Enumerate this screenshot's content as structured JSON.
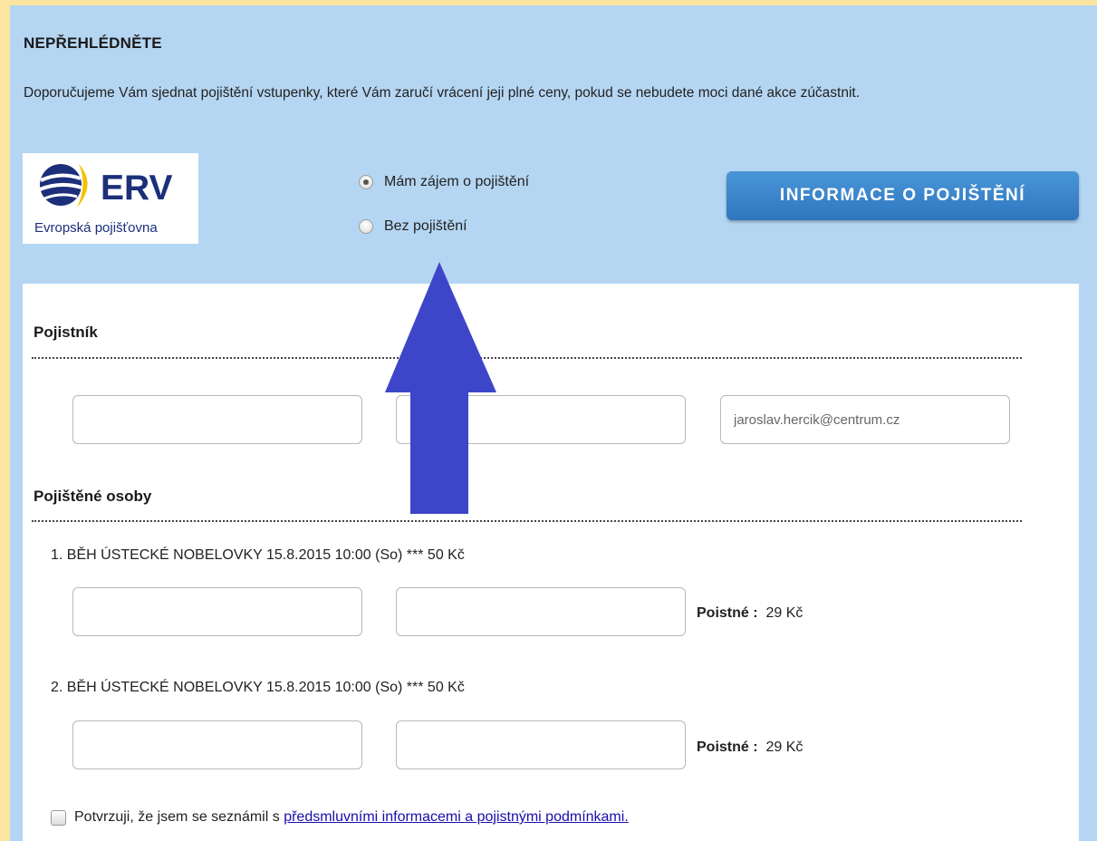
{
  "notice": {
    "title": "NEPŘEHLÉDNĚTE",
    "text": "Doporučujeme Vám sjednat pojištění vstupenky, které Vám zaručí vrácení jeji plné ceny, pokud se nebudete moci dané akce zúčastnit."
  },
  "logo": {
    "brand": "ERV",
    "subtitle": "Evropská pojišťovna",
    "colors": {
      "globe": "#1b2f7a",
      "swoosh": "#f2c200",
      "text": "#1b2f7a"
    }
  },
  "insurance_options": [
    {
      "label": "Mám zájem o pojištění",
      "selected": true
    },
    {
      "label": "Bez pojištění",
      "selected": false
    }
  ],
  "info_button": {
    "label": "INFORMACE O POJIŠTĚNÍ",
    "color": "#3a86cc"
  },
  "policyholder": {
    "title": "Pojistník",
    "fields": [
      {
        "value": "",
        "placeholder": ""
      },
      {
        "value": "",
        "placeholder": ""
      },
      {
        "value": "",
        "placeholder": "jaroslav.hercik@centrum.cz"
      }
    ]
  },
  "insured": {
    "title": "Pojištěné osoby",
    "persons": [
      {
        "event": "1. BĚH ÚSTECKÉ NOBELOVKY 15.8.2015 10:00 (So) *** 50 Kč",
        "premium_label": "Poistné :",
        "premium_value": "29 Kč"
      },
      {
        "event": "2. BĚH ÚSTECKÉ NOBELOVKY 15.8.2015 10:00 (So) *** 50 Kč",
        "premium_label": "Poistné :",
        "premium_value": "29 Kč"
      }
    ]
  },
  "consent": {
    "text": "Potvrzuji, že jsem se seznámil s ",
    "link": "předsmluvními informacemi a pojistnými podmínkami.",
    "checked": false
  },
  "annotation": {
    "icon": "up-arrow-icon",
    "color": "#3d46c9"
  }
}
